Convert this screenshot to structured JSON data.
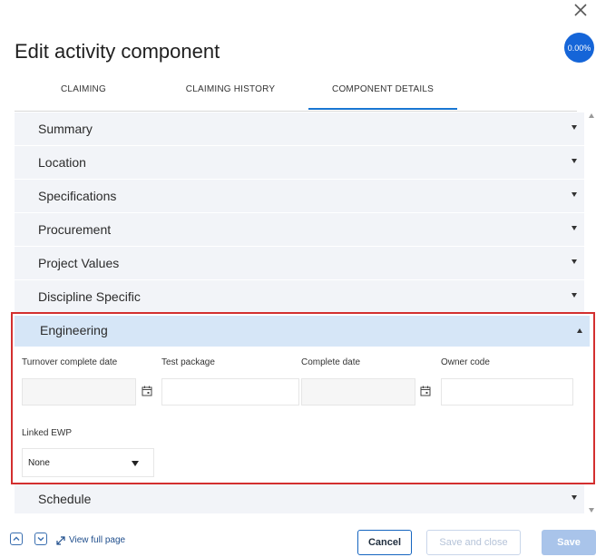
{
  "dialog": {
    "title": "Edit activity component",
    "progress_badge": "0.00%",
    "accent_color": "#1565d8"
  },
  "tabs": [
    {
      "label": "CLAIMING",
      "active": false
    },
    {
      "label": "CLAIMING HISTORY",
      "active": false
    },
    {
      "label": "COMPONENT DETAILS",
      "active": true
    }
  ],
  "sections": [
    {
      "label": "Summary",
      "expanded": false
    },
    {
      "label": "Location",
      "expanded": false
    },
    {
      "label": "Specifications",
      "expanded": false
    },
    {
      "label": "Procurement",
      "expanded": false
    },
    {
      "label": "Project Values",
      "expanded": false
    },
    {
      "label": "Discipline Specific",
      "expanded": false
    }
  ],
  "engineering": {
    "label": "Engineering",
    "expanded": true,
    "fields": {
      "turnover_complete_date": {
        "label": "Turnover complete date",
        "value": ""
      },
      "test_package": {
        "label": "Test package",
        "value": ""
      },
      "complete_date": {
        "label": "Complete date",
        "value": ""
      },
      "owner_code": {
        "label": "Owner code",
        "value": ""
      },
      "linked_ewp": {
        "label": "Linked EWP",
        "value": "None"
      }
    }
  },
  "schedule": {
    "label": "Schedule",
    "expanded": false
  },
  "footer": {
    "view_full_page": "View full page",
    "cancel": "Cancel",
    "save_and_close": "Save and close",
    "save": "Save"
  }
}
